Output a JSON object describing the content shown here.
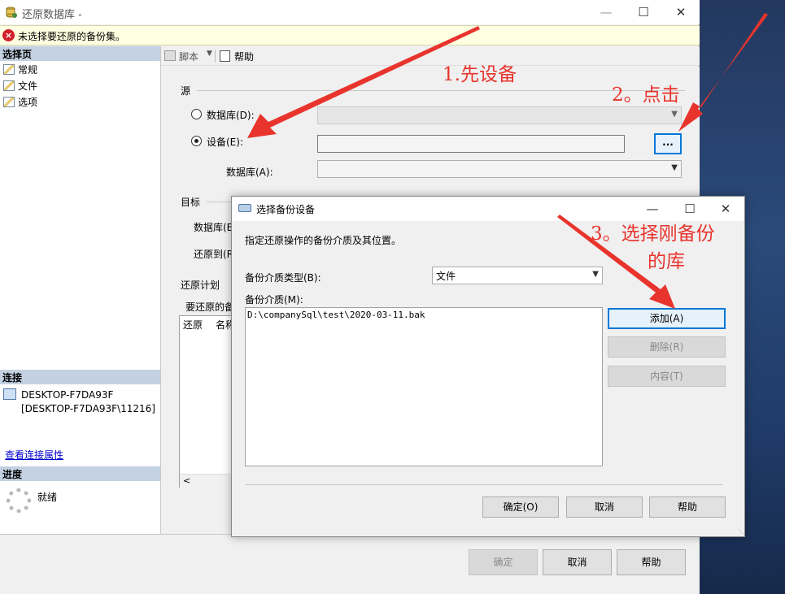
{
  "main_window": {
    "title": "还原数据库 -",
    "error_message": "未选择要还原的备份集。"
  },
  "left_pane": {
    "select_page_header": "选择页",
    "pages": [
      "常规",
      "文件",
      "选项"
    ],
    "connection_header": "连接",
    "connection_line1": "DESKTOP-F7DA93F",
    "connection_line2": "[DESKTOP-F7DA93F\\11216]",
    "view_connection_link": "查看连接属性",
    "progress_header": "进度",
    "progress_status": "就绪"
  },
  "toolbar": {
    "script_label": "脚本",
    "help_label": "帮助"
  },
  "source": {
    "group_label": "源",
    "database_radio_label": "数据库(D):",
    "device_radio_label": "设备(E):",
    "device_database_label": "数据库(A):",
    "browse_button_label": "..."
  },
  "target": {
    "group_label": "目标",
    "database_label": "数据库(B",
    "restore_to_label": "还原到(R"
  },
  "restore_plan": {
    "group_label": "还原计划",
    "backup_sets_label": "要还原的备",
    "col_restore": "还原",
    "col_name": "名称"
  },
  "footer": {
    "ok_label": "确定",
    "cancel_label": "取消",
    "help_label": "帮助"
  },
  "dialog": {
    "title": "选择备份设备",
    "description": "指定还原操作的备份介质及其位置。",
    "media_type_label": "备份介质类型(B):",
    "media_type_value": "文件",
    "media_label": "备份介质(M):",
    "media_items": [
      "D:\\companySql\\test\\2020-03-11.bak"
    ],
    "add_label": "添加(A)",
    "remove_label": "删除(R)",
    "contents_label": "内容(T)",
    "ok_label": "确定(O)",
    "cancel_label": "取消",
    "help_label": "帮助"
  },
  "annotations": {
    "step1": "1.先设备",
    "step2": "2。点击",
    "step3_line1": "3。选择刚备份",
    "step3_line2": "的库"
  },
  "colors": {
    "annotation": "#e8342d",
    "focus_border": "#0078d7",
    "error_bar": "#ffffe1",
    "pane_header": "#c3d1e2"
  }
}
